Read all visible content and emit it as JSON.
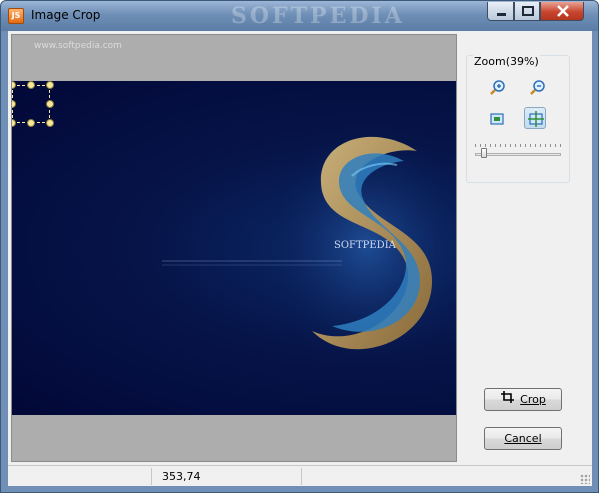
{
  "window": {
    "title": "Image Crop",
    "app_icon": "JS",
    "titlebar_watermark": "SOFTPEDIA",
    "controls": {
      "minimize": "minimize-icon",
      "maximize": "maximize-icon",
      "close": "close-icon"
    }
  },
  "canvas": {
    "watermark": "www.softpedia.com",
    "image_description_icon": "island-photo",
    "image_watermark": "SOFTPEDIA"
  },
  "zoom": {
    "label": "Zoom(39%)",
    "level_percent": 39,
    "tools": [
      "zoom-in-icon",
      "zoom-out-icon",
      "actual-size-icon",
      "fit-to-window-icon"
    ]
  },
  "buttons": {
    "crop": "Crop",
    "cancel": "Cancel"
  },
  "status": {
    "coordinates": "353,74"
  },
  "colors": {
    "accent": "#6f8fb6",
    "image_bg": "#061448",
    "handle": "#f6e79a"
  }
}
